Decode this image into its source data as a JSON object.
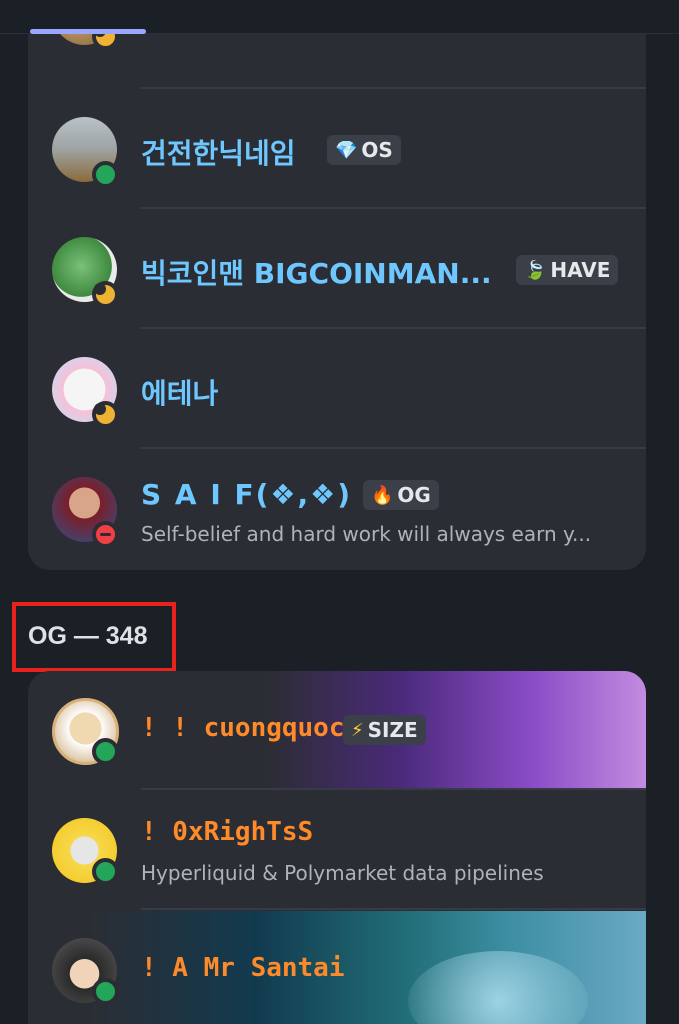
{
  "sections": [
    {
      "members": [
        {
          "name": "건전한닉네임",
          "tag": {
            "icon": "diamond-icon",
            "label": "OS"
          },
          "status": "online"
        },
        {
          "name": "빅코인맨 BIGCOINMAN...",
          "tag": {
            "icon": "leaf-icon",
            "label": "HAVE"
          },
          "status": "idle"
        },
        {
          "name": "에테나",
          "status": "idle"
        },
        {
          "name": "S A I F(❖,❖)",
          "tag": {
            "icon": "flame-icon",
            "label": "OG"
          },
          "subtitle": "Self-belief and hard work will always earn y...",
          "status": "dnd"
        }
      ]
    },
    {
      "header": "OG — 348",
      "members": [
        {
          "name": "! ! cuongquoc",
          "tag": {
            "icon": "lightning-icon",
            "label": "SIZE"
          },
          "status": "online"
        },
        {
          "name": "! 0xRighTsS",
          "subtitle": "Hyperliquid & Polymarket data pipelines",
          "status": "online"
        },
        {
          "name": "! A Mr Santai",
          "status": "online"
        }
      ]
    }
  ],
  "colors": {
    "background": "#1b1f26",
    "card": "#2b2d34",
    "name_cyan": "#6ec8ff",
    "name_orange": "#ff8a2a",
    "online": "#23a55a",
    "idle": "#f0b232",
    "dnd": "#f23f43",
    "highlight": "#e8231d"
  }
}
